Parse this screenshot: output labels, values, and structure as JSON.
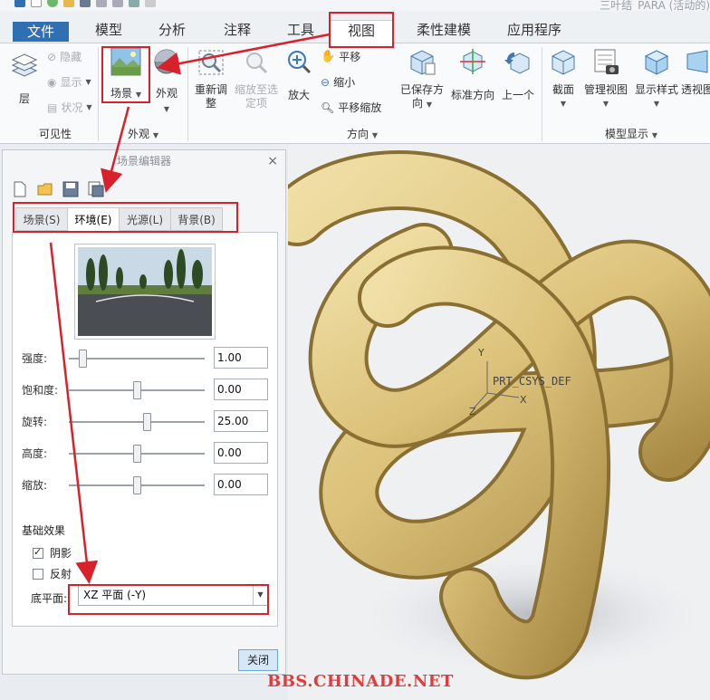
{
  "window": {
    "title": "三叶结_PARA (活动的)"
  },
  "tabs": [
    {
      "label": "文件"
    },
    {
      "label": "模型"
    },
    {
      "label": "分析"
    },
    {
      "label": "注释"
    },
    {
      "label": "工具"
    },
    {
      "label": "视图"
    },
    {
      "label": "柔性建模"
    },
    {
      "label": "应用程序"
    }
  ],
  "ribbon": {
    "visibility": {
      "layer_label": "层",
      "hide_label": "隐藏",
      "show_label": "显示",
      "status_label": "状况",
      "group_label": "可见性"
    },
    "appearance": {
      "scene_label": "场景",
      "appearance_label": "外观",
      "group_label": "外观"
    },
    "orientation": {
      "refit_label_1": "重新调",
      "refit_label_2": "整",
      "zoom_sel_label_1": "缩放至选",
      "zoom_sel_label_2": "定项",
      "zoom_in_label": "放大",
      "pan_label": "平移",
      "zoom_out_label": "缩小",
      "pan_zoom_label": "平移缩放",
      "saved_label_1": "已保存方",
      "saved_label_2": "向",
      "std_label": "标准方向",
      "prev_label": "上一个",
      "group_label": "方向"
    },
    "model_display": {
      "section_label": "截面",
      "manage_label": "管理视图",
      "style_label": "显示样式",
      "persp_label": "透视图",
      "group_label": "模型显示"
    }
  },
  "dialog": {
    "title": "场景编辑器",
    "tabs": [
      {
        "label": "场景(S)"
      },
      {
        "label": "环境(E)"
      },
      {
        "label": "光源(L)"
      },
      {
        "label": "背景(B)"
      }
    ],
    "sliders": [
      {
        "label": "强度:",
        "value": "1.00",
        "level": 0.1
      },
      {
        "label": "饱和度:",
        "value": "0.00",
        "level": 0.5
      },
      {
        "label": "旋转:",
        "value": "25.00",
        "level": 0.57
      },
      {
        "label": "高度:",
        "value": "0.00",
        "level": 0.5
      },
      {
        "label": "缩放:",
        "value": "0.00",
        "level": 0.5
      }
    ],
    "basic_effects_label": "基础效果",
    "shadow": {
      "label": "阴影",
      "checked": true
    },
    "reflection": {
      "label": "反射",
      "checked": false
    },
    "floor_label": "底平面:",
    "floor_value": "XZ 平面 (-Y)",
    "close_label": "关闭"
  },
  "viewport": {
    "csys_name": "PRT_CSYS_DEF",
    "axis_x": "X",
    "axis_y": "Y",
    "axis_z": "Z"
  },
  "watermark": "BBS.CHINADE.NET",
  "colors": {
    "annotation": "#d8222b",
    "file_tab": "#2f6fb3",
    "knot": "#e0c782"
  }
}
